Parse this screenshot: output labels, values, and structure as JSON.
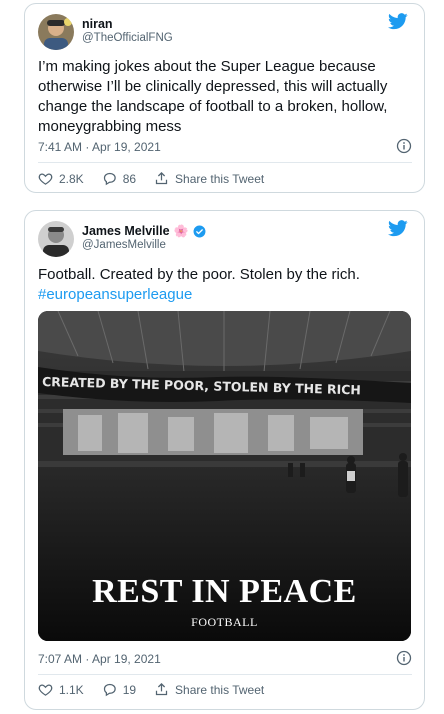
{
  "tweets": [
    {
      "author_name": "niran",
      "author_handle": "@TheOfficialFNG",
      "text": "I’m making jokes about the Super League because otherwise I’ll be clinically depressed, this will actually change the landscape of football to a broken, hollow, moneygrabbing mess",
      "timestamp": "7:41 AM · Apr 19, 2021",
      "likes": "2.8K",
      "replies": "86",
      "share_label": "Share this Tweet"
    },
    {
      "author_name": "James Melville",
      "author_emoji": "🌸",
      "author_handle": "@JamesMelville",
      "text": "Football. Created by the poor. Stolen by the rich.",
      "hashtag": "#europeansuperleague",
      "media": {
        "banner_text": "CREATED BY THE POOR, STOLEN BY THE RICH",
        "title": "REST IN PEACE",
        "subtitle": "FOOTBALL"
      },
      "timestamp": "7:07 AM · Apr 19, 2021",
      "likes": "1.1K",
      "replies": "19",
      "share_label": "Share this Tweet"
    }
  ],
  "colors": {
    "twitter_blue": "#1d9bf0",
    "text_primary": "#0f1419",
    "text_secondary": "#536471",
    "border": "#cfd9de",
    "verified_blue": "#1d9bf0"
  },
  "icons": [
    "twitter-bird-icon",
    "info-icon",
    "heart-icon",
    "reply-icon",
    "share-icon",
    "verified-badge-icon"
  ]
}
